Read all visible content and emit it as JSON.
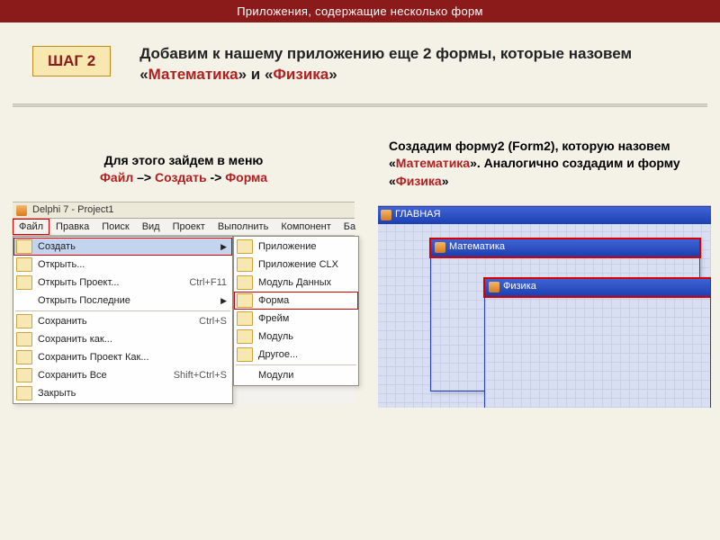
{
  "header_title": "Приложения, содержащие несколько форм",
  "step_label": "ШАГ 2",
  "heading": {
    "pre": "Добавим к нашему приложению еще 2 формы, которые назовем «",
    "hl1": "Математика",
    "mid": "» и «",
    "hl2": "Физика",
    "post": "»"
  },
  "left_caption": {
    "l1": "Для этого зайдем в меню",
    "file": "Файл",
    "sep1": " –> ",
    "create": "Создать",
    "sep2": " -> ",
    "form": "Форма"
  },
  "right_caption": {
    "t1": "Создадим форму2 (Form2), которую назовем «",
    "hl1": "Математика",
    "t2": "». Аналогично создадим и форму «",
    "hl2": "Физика",
    "t3": "»"
  },
  "ide": {
    "title": "Delphi 7 - Project1",
    "menubar": [
      "Файл",
      "Правка",
      "Поиск",
      "Вид",
      "Проект",
      "Выполнить",
      "Компонент",
      "Ба"
    ],
    "file_menu": [
      {
        "label": "Создать",
        "shortcut": "",
        "arrow": true,
        "hover": true,
        "box": true
      },
      {
        "label": "Открыть...",
        "shortcut": ""
      },
      {
        "label": "Открыть Проект...",
        "shortcut": "Ctrl+F11"
      },
      {
        "label": "Открыть Последние",
        "shortcut": "",
        "arrow": true
      },
      {
        "sep": true
      },
      {
        "label": "Сохранить",
        "shortcut": "Ctrl+S"
      },
      {
        "label": "Сохранить как...",
        "shortcut": ""
      },
      {
        "label": "Сохранить Проект Как...",
        "shortcut": ""
      },
      {
        "label": "Сохранить Все",
        "shortcut": "Shift+Ctrl+S"
      },
      {
        "label": "Закрыть",
        "shortcut": ""
      }
    ],
    "submenu": [
      {
        "label": "Приложение"
      },
      {
        "label": "Приложение CLX"
      },
      {
        "label": "Модуль Данных"
      },
      {
        "label": "Форма",
        "box": true
      },
      {
        "label": "Фрейм"
      },
      {
        "label": "Модуль"
      },
      {
        "label": "Другое..."
      },
      {
        "sep": true
      },
      {
        "label": "Модули"
      }
    ]
  },
  "forms": {
    "main": "ГЛАВНАЯ",
    "math": "Математика",
    "phys": "Физика"
  }
}
